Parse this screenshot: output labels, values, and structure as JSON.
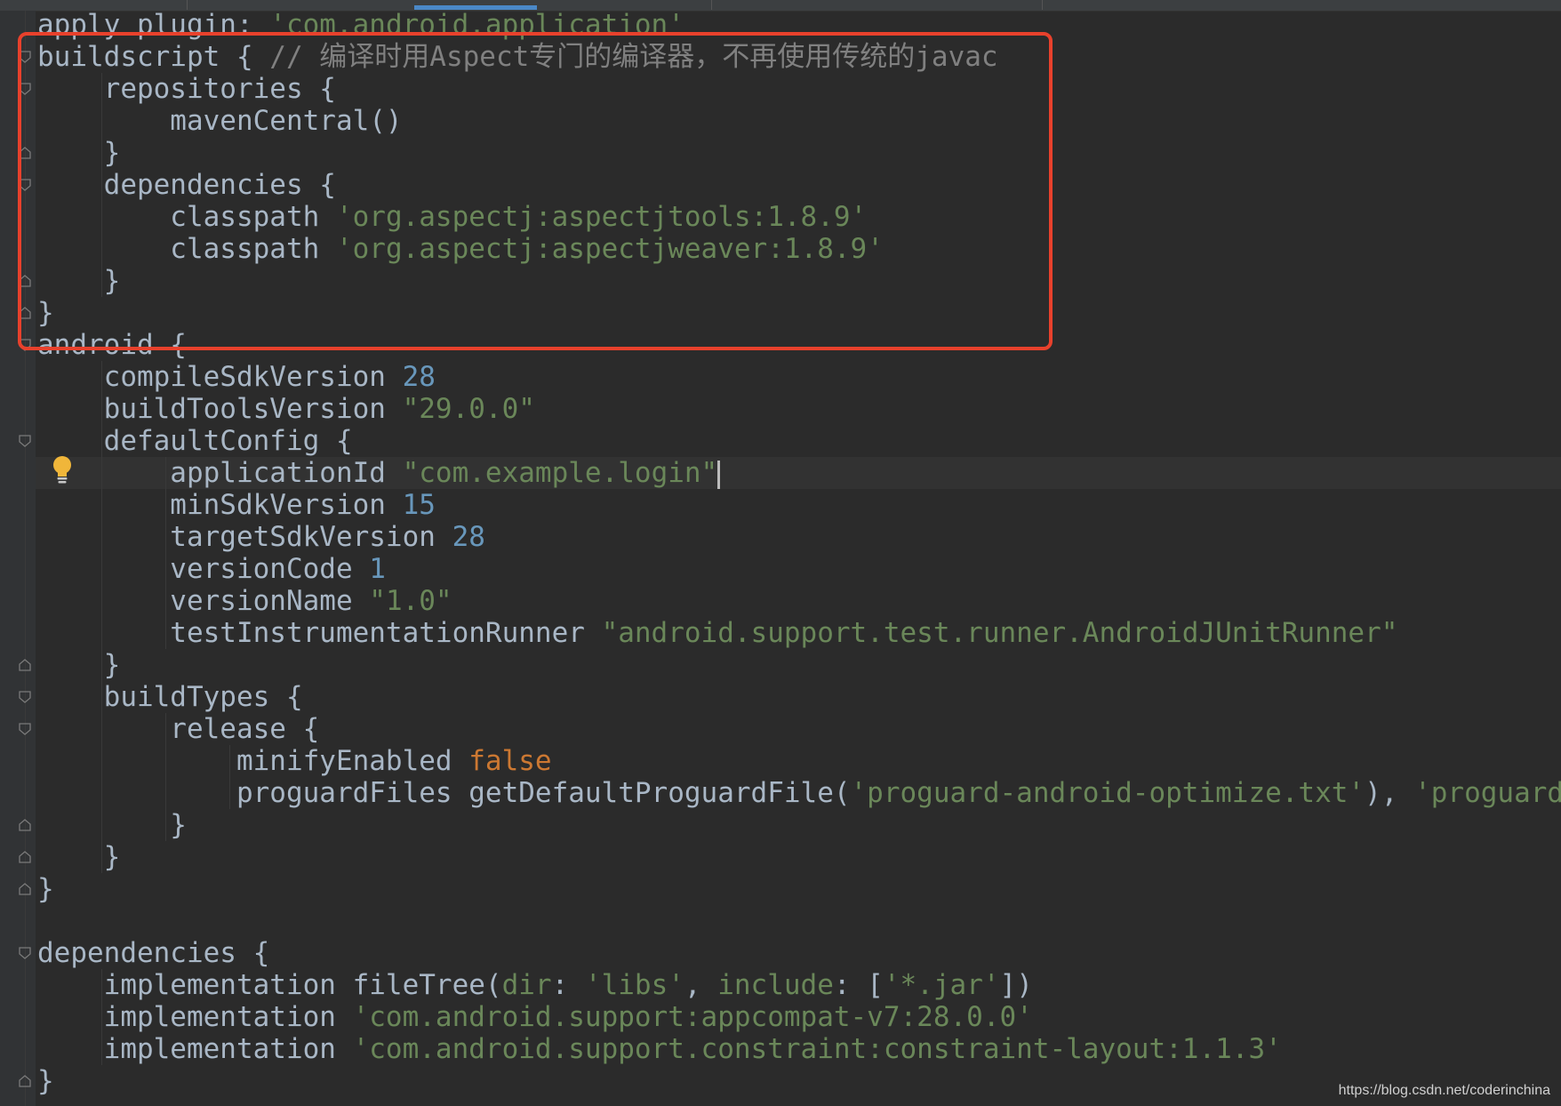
{
  "editor": {
    "lines": [
      [
        [
          "t",
          "apply plugin: "
        ],
        [
          "s",
          "'com.android.application'"
        ]
      ],
      [
        [
          "t",
          "buildscript { "
        ],
        [
          "c",
          "// 编译时用Aspect专门的编译器，不再使用传统的javac"
        ]
      ],
      [
        [
          "t",
          "    repositories {"
        ]
      ],
      [
        [
          "t",
          "        mavenCentral()"
        ]
      ],
      [
        [
          "t",
          "    }"
        ]
      ],
      [
        [
          "t",
          "    dependencies {"
        ]
      ],
      [
        [
          "t",
          "        classpath "
        ],
        [
          "s",
          "'org.aspectj:aspectjtools:1.8.9'"
        ]
      ],
      [
        [
          "t",
          "        classpath "
        ],
        [
          "s",
          "'org.aspectj:aspectjweaver:1.8.9'"
        ]
      ],
      [
        [
          "t",
          "    }"
        ]
      ],
      [
        [
          "t",
          "}"
        ]
      ],
      [
        [
          "t",
          "android {"
        ]
      ],
      [
        [
          "t",
          "    compileSdkVersion "
        ],
        [
          "n",
          "28"
        ]
      ],
      [
        [
          "t",
          "    buildToolsVersion "
        ],
        [
          "s",
          "\"29.0.0\""
        ]
      ],
      [
        [
          "t",
          "    defaultConfig {"
        ]
      ],
      [
        [
          "t",
          "        applicationId "
        ],
        [
          "s",
          "\"com.example.login\""
        ],
        [
          "caret",
          ""
        ]
      ],
      [
        [
          "t",
          "        minSdkVersion "
        ],
        [
          "n",
          "15"
        ]
      ],
      [
        [
          "t",
          "        targetSdkVersion "
        ],
        [
          "n",
          "28"
        ]
      ],
      [
        [
          "t",
          "        versionCode "
        ],
        [
          "n",
          "1"
        ]
      ],
      [
        [
          "t",
          "        versionName "
        ],
        [
          "s",
          "\"1.0\""
        ]
      ],
      [
        [
          "t",
          "        testInstrumentationRunner "
        ],
        [
          "s",
          "\"android.support.test.runner.AndroidJUnitRunner\""
        ]
      ],
      [
        [
          "t",
          "    }"
        ]
      ],
      [
        [
          "t",
          "    buildTypes {"
        ]
      ],
      [
        [
          "t",
          "        release {"
        ]
      ],
      [
        [
          "t",
          "            minifyEnabled "
        ],
        [
          "k",
          "false"
        ]
      ],
      [
        [
          "t",
          "            proguardFiles getDefaultProguardFile("
        ],
        [
          "s",
          "'proguard-android-optimize.txt'"
        ],
        [
          "t",
          "), "
        ],
        [
          "s",
          "'proguard-ru"
        ]
      ],
      [
        [
          "t",
          "        }"
        ]
      ],
      [
        [
          "t",
          "    }"
        ]
      ],
      [
        [
          "t",
          "}"
        ]
      ],
      [
        [
          "t",
          ""
        ]
      ],
      [
        [
          "t",
          "dependencies {"
        ]
      ],
      [
        [
          "t",
          "    implementation fileTree("
        ],
        [
          "s",
          "dir"
        ],
        [
          "t",
          ": "
        ],
        [
          "s",
          "'libs'"
        ],
        [
          "t",
          ", "
        ],
        [
          "s",
          "include"
        ],
        [
          "t",
          ": ["
        ],
        [
          "s",
          "'*.jar'"
        ],
        [
          "t",
          "])"
        ]
      ],
      [
        [
          "t",
          "    implementation "
        ],
        [
          "s",
          "'com.android.support:appcompat-v7:28.0.0'"
        ]
      ],
      [
        [
          "t",
          "    implementation "
        ],
        [
          "s",
          "'com.android.support.constraint:constraint-layout:1.1.3'"
        ]
      ],
      [
        [
          "t",
          "}"
        ]
      ]
    ],
    "caret_line": 14,
    "icons": {
      "fold": "fold-marker-icon",
      "intention": "lightbulb-icon"
    },
    "colors": {
      "background": "#2b2b2b",
      "text": "#a9b7c6",
      "string": "#6a8759",
      "number": "#6897bb",
      "keyword": "#cc7832",
      "comment": "#808080",
      "highlight_box": "#e8412c"
    }
  },
  "watermark": "https://blog.csdn.net/coderinchina"
}
